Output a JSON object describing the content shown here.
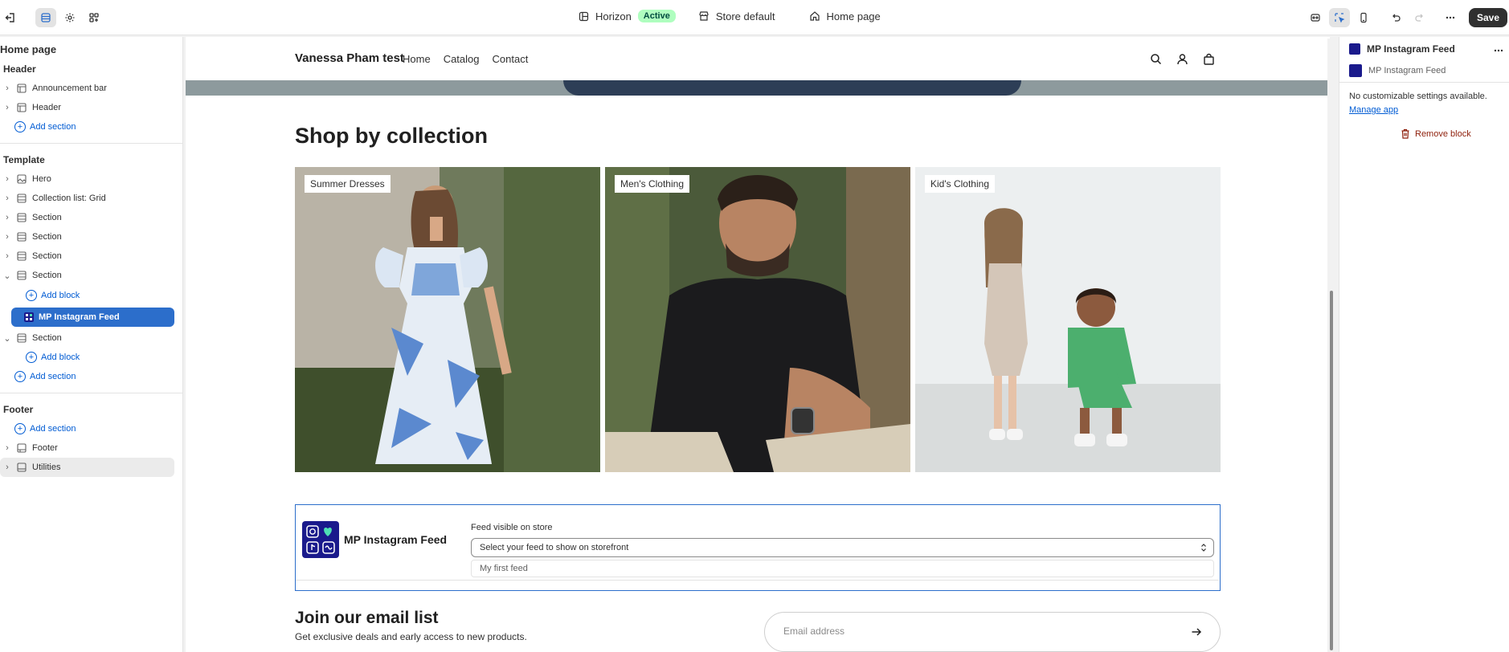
{
  "topbar": {
    "theme_name": "Horizon",
    "theme_status": "Active",
    "store_context": "Store default",
    "page": "Home page",
    "save_label": "Save",
    "left_icons": [
      "exit-icon",
      "sections-icon",
      "settings-icon",
      "apps-icon"
    ],
    "right_icons": [
      "preview-icon",
      "inspector-icon",
      "mobile-icon",
      "undo-icon",
      "redo-icon",
      "more-icon"
    ]
  },
  "sidebar": {
    "title": "Home page",
    "header_group": {
      "title": "Header",
      "items": [
        "Announcement bar",
        "Header"
      ],
      "add_label": "Add section"
    },
    "template_group": {
      "title": "Template",
      "items": [
        "Hero",
        "Collection list: Grid",
        "Section",
        "Section",
        "Section",
        "Section"
      ],
      "add_block_label": "Add block",
      "selected_block": "MP Instagram Feed",
      "after_items": [
        "Section"
      ],
      "add_block_label_2": "Add block",
      "add_section_label": "Add section"
    },
    "footer_group": {
      "title": "Footer",
      "add_section_label": "Add section",
      "items": [
        "Footer",
        "Utilities"
      ]
    }
  },
  "storefront": {
    "store_name": "Vanessa Pham test",
    "nav": [
      "Home",
      "Catalog",
      "Contact"
    ],
    "section_title": "Shop by collection",
    "collections": [
      "Summer Dresses",
      "Men's Clothing",
      "Kid's Clothing"
    ],
    "app_block": {
      "name": "MP Instagram Feed",
      "feed_label": "Feed visible on store",
      "select_placeholder": "Select your feed to show on storefront",
      "option": "My first feed"
    },
    "email": {
      "title": "Join our email list",
      "subtitle": "Get exclusive deals and early access to new products.",
      "placeholder": "Email address"
    }
  },
  "inspector": {
    "title": "MP Instagram Feed",
    "subtitle": "MP Instagram Feed",
    "note": "No customizable settings available.",
    "manage_link": "Manage app",
    "remove_label": "Remove block"
  },
  "colors": {
    "accent": "#2c6ecb",
    "link": "#005bd3",
    "active_badge": "#affebf",
    "destructive": "#8e1f0b",
    "app_logo": "#1a1a8c"
  }
}
